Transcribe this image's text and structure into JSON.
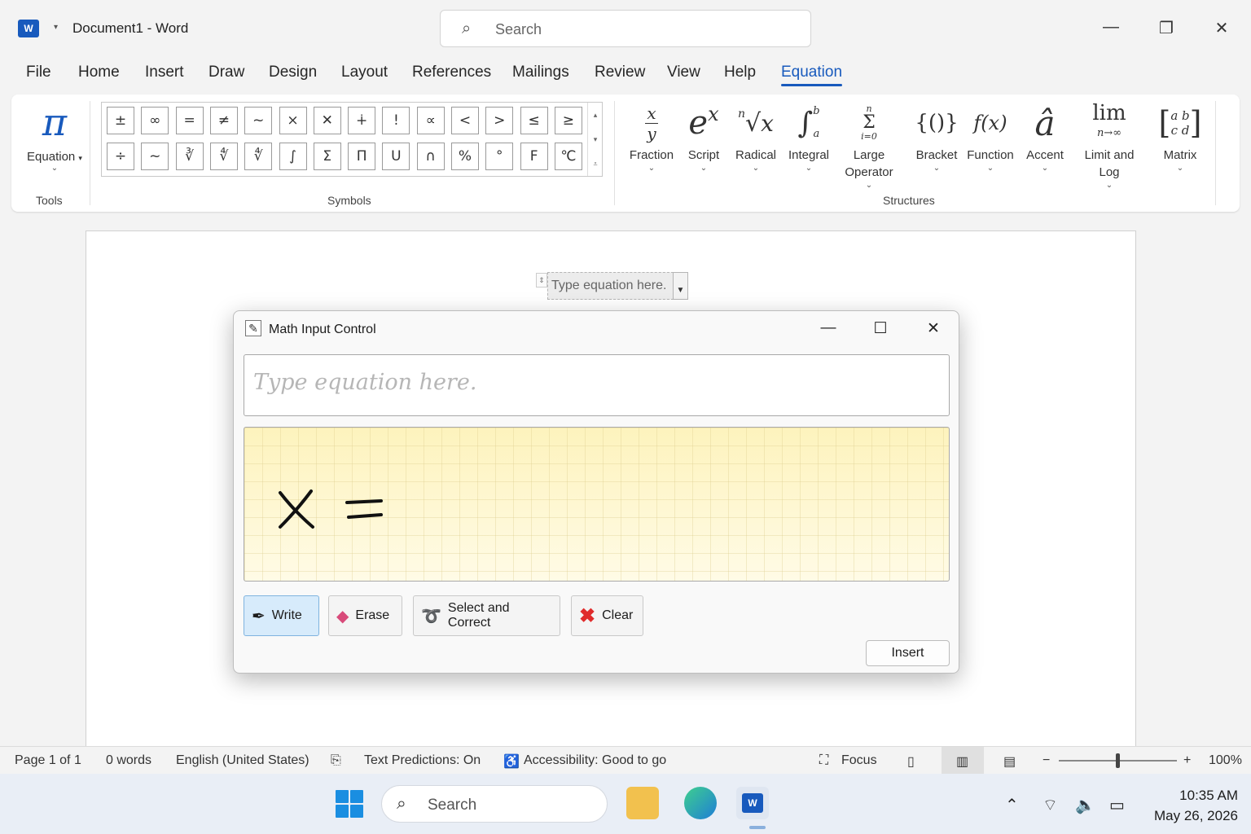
{
  "titlebar": {
    "app_logo": "W",
    "doc_title": "Document1  -  Word",
    "search_placeholder": "Search"
  },
  "menu_tabs": [
    "File",
    "Home",
    "Insert",
    "Draw",
    "Design",
    "Layout",
    "References",
    "Mailings",
    "Review",
    "View",
    "Help",
    "Equation"
  ],
  "active_tab": "Equation",
  "ribbon": {
    "tools": {
      "label": "Equation",
      "glyph": "π",
      "group_label": "Tools"
    },
    "symbols": {
      "group_label": "Symbols",
      "row1": [
        "±",
        "∞",
        "=",
        "≠",
        "~",
        "×",
        "÷",
        "!",
        "α",
        "<",
        ">",
        "≤",
        "≥"
      ],
      "row2": [
        "∓",
        "≅",
        "≈",
        "≡",
        "∀",
        "∁",
        "∂",
        "√",
        "∛",
        "∜",
        "∪",
        "∩",
        "∅"
      ],
      "visible_row1": [
        "±",
        "∞",
        "=",
        "≠",
        "~",
        "×",
        "✕",
        "∔",
        "!",
        "∝",
        "<",
        ">",
        "≤",
        "≥"
      ],
      "visible_row2": [
        "÷",
        "~",
        "∛",
        "∜",
        "∜",
        "∫",
        "Σ",
        "Π",
        "U",
        "∩",
        "%",
        "°",
        "F",
        "℃"
      ]
    },
    "structures": {
      "group_label": "Structures",
      "items": [
        {
          "label": "Fraction"
        },
        {
          "label": "Script"
        },
        {
          "label": "Radical"
        },
        {
          "label": "Integral"
        },
        {
          "label": "Large Operator"
        },
        {
          "label": "Bracket"
        },
        {
          "label": "Function"
        },
        {
          "label": "Accent"
        },
        {
          "label": "Limit and Log"
        },
        {
          "label": "Matrix"
        }
      ]
    }
  },
  "document": {
    "equation_placeholder": "Type equation here."
  },
  "dialog": {
    "title": "Math Input Control",
    "preview_placeholder": "Type equation here.",
    "handwriting": "x =",
    "buttons": {
      "write": "Write",
      "erase": "Erase",
      "select": "Select and Correct",
      "clear": "Clear",
      "insert": "Insert"
    }
  },
  "statusbar": {
    "page": "Page 1 of 1",
    "words": "0 words",
    "language": "English (United States)",
    "predictions": "Text Predictions: On",
    "accessibility": "Accessibility: Good to go",
    "focus": "Focus",
    "zoom_minus": "−",
    "zoom_plus": "+",
    "zoom": "100%"
  },
  "taskbar": {
    "search_placeholder": "Search",
    "time": "10:35 AM",
    "date": "May 26, 2026"
  },
  "colors": {
    "accent": "#185abd",
    "writing_pad": "#fff6c9",
    "clear_red": "#e02b2b"
  }
}
